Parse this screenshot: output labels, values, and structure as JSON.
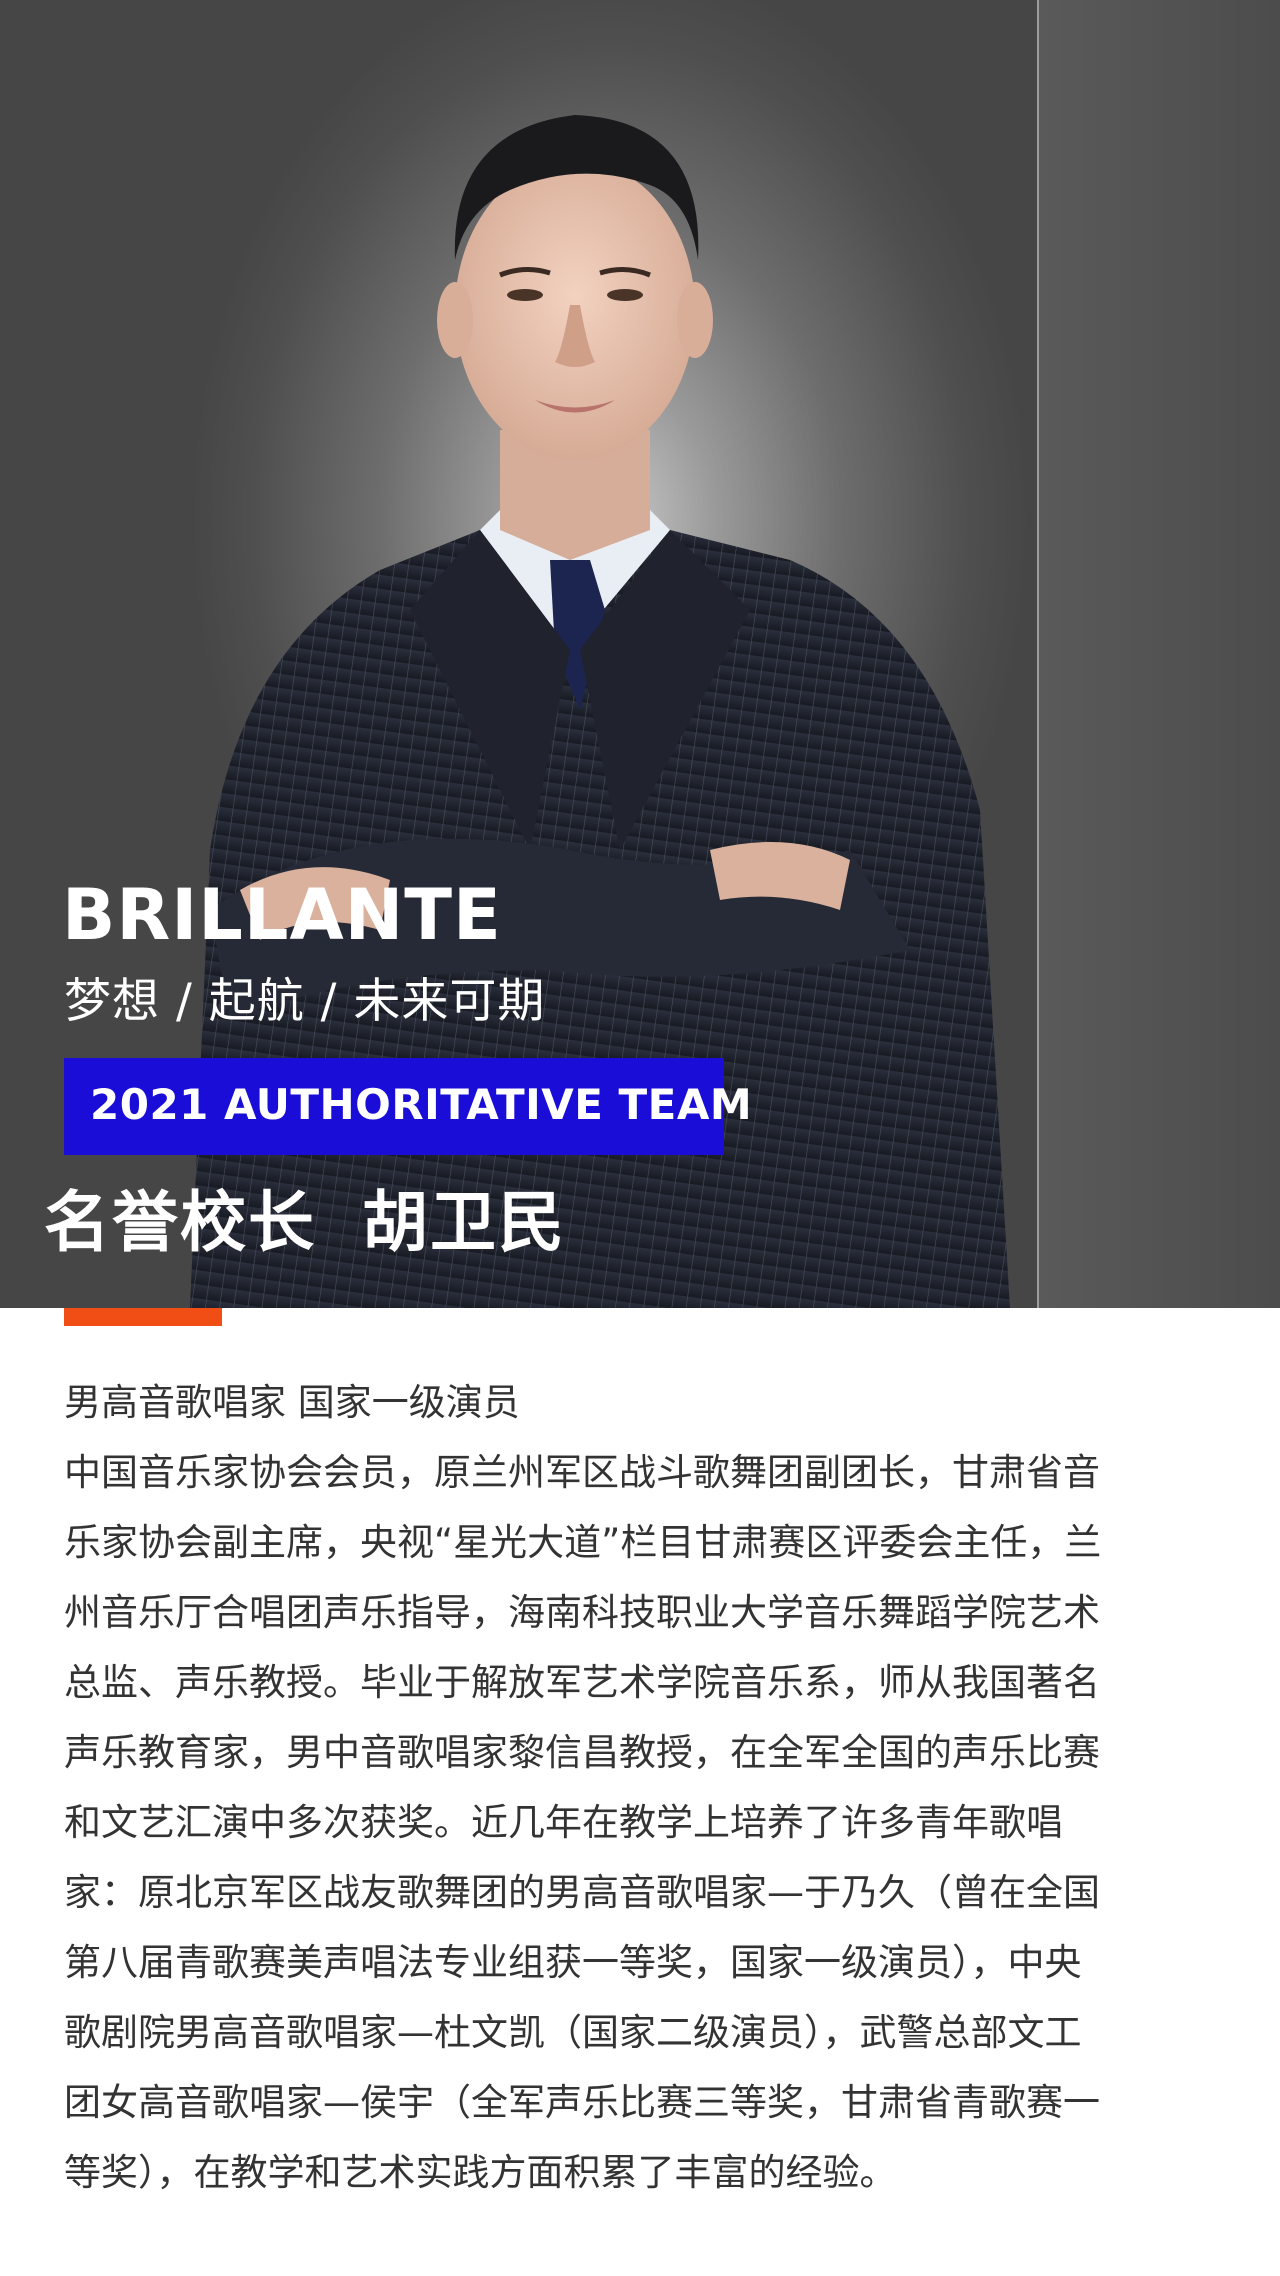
{
  "brand": "BRILLANTE",
  "slogan": "梦想 / 起航 / 未来可期",
  "team_badge": "2021 AUTHORITATIVE TEAM",
  "position_title": "名誉校长",
  "person_name": "胡卫民",
  "colors": {
    "badge": "#1a0dd8",
    "accent": "#f04e14",
    "hero_background": "#4a4a4a",
    "body_text": "#333333"
  },
  "bio_lines": [
    "男高音歌唱家 国家一级演员",
    "中国音乐家协会会员，原兰州军区战斗歌舞团副团长，甘肃省音",
    "乐家协会副主席，央视“星光大道”栏目甘肃赛区评委会主任，兰",
    "州音乐厅合唱团声乐指导，海南科技职业大学音乐舞蹈学院艺术",
    "总监、声乐教授。毕业于解放军艺术学院音乐系，师从我国著名",
    "声乐教育家，男中音歌唱家黎信昌教授，在全军全国的声乐比赛",
    "和文艺汇演中多次获奖。近几年在教学上培养了许多青年歌唱",
    "家：原北京军区战友歌舞团的男高音歌唱家—于乃久（曾在全国",
    "第八届青歌赛美声唱法专业组获一等奖，国家一级演员），中央",
    "歌剧院男高音歌唱家—杜文凯（国家二级演员），武警总部文工",
    "团女高音歌唱家—侯宇（全军声乐比赛三等奖，甘肃省青歌赛一",
    "等奖），在教学和艺术实践方面积累了丰富的经验。"
  ]
}
